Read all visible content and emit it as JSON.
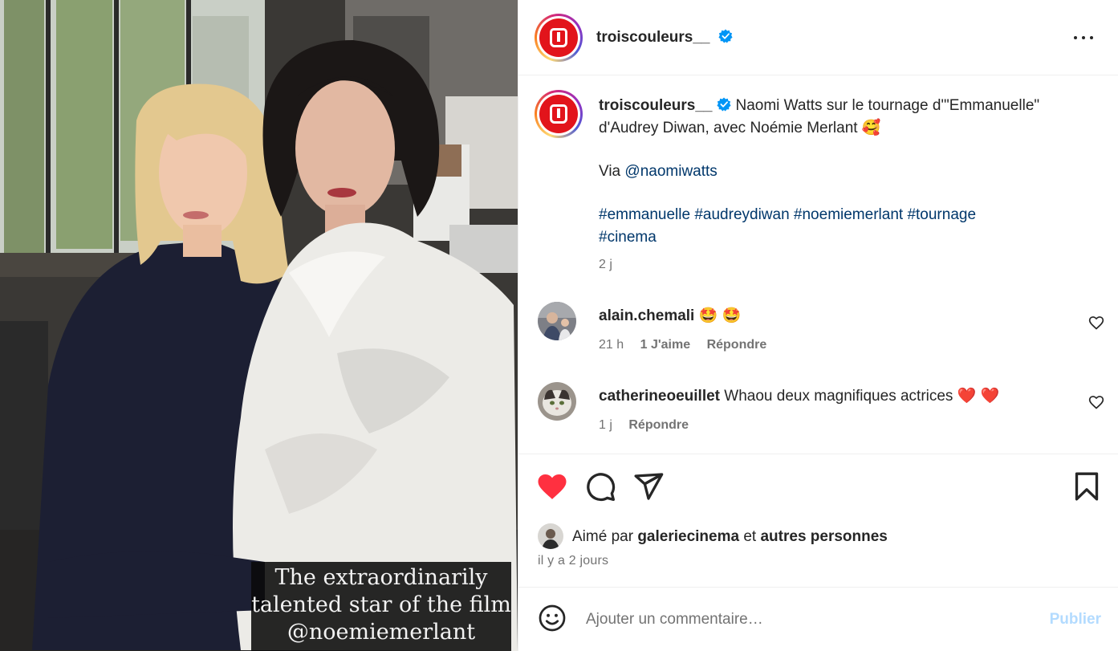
{
  "photo": {
    "caption_lines": [
      "The extraordinarily",
      "talented star of the film",
      "@noemiemerlant"
    ]
  },
  "header": {
    "username": "troiscouleurs__",
    "verified_icon": "verified-badge-icon",
    "more_icon": "more-horizontal-icon"
  },
  "caption": {
    "username": "troiscouleurs__",
    "text": "Naomi Watts sur le tournage d'\"Emmanuelle\" d'Audrey Diwan, avec Noémie Merlant 🥰",
    "via_label": "Via",
    "via_mention": "@naomiwatts",
    "hashtags_line1": "#emmanuelle #audreydiwan #noemiemerlant #tournage",
    "hashtags_line2": "#cinema",
    "time": "2 j"
  },
  "comments": [
    {
      "username": "alain.chemali",
      "text": "🤩 🤩",
      "time": "21 h",
      "likes": "1 J'aime",
      "reply": "Répondre"
    },
    {
      "username": "catherineoeuillet",
      "text": "Whaou deux magnifiques actrices ❤️ ❤️",
      "time": "1 j",
      "reply": "Répondre"
    }
  ],
  "actions": {
    "like_icon": "heart-filled-icon",
    "comment_icon": "comment-icon",
    "share_icon": "send-icon",
    "save_icon": "bookmark-icon",
    "like_color": "#ff3040"
  },
  "likes": {
    "prefix": "Aimé par",
    "user": "galeriecinema",
    "conjunction": "et",
    "others": "autres personnes"
  },
  "time_ago": "il y a 2 jours",
  "comment_box": {
    "emoji_icon": "emoji-icon",
    "placeholder": "Ajouter un commentaire…",
    "publish_label": "Publier",
    "publish_color": "#b3dbff"
  },
  "colors": {
    "brand_red": "#e2141b",
    "link": "#00376b",
    "verified": "#0095f6",
    "muted": "#737373"
  }
}
